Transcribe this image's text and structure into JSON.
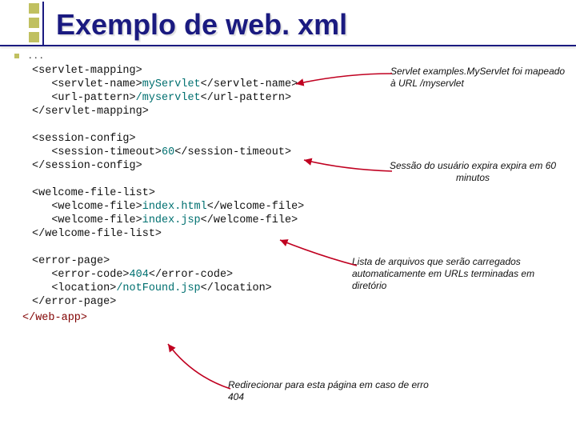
{
  "title": "Exemplo de web. xml",
  "dots": ". . .",
  "code": {
    "sm_open": "<servlet-mapping>",
    "sn_open": "<servlet-name>",
    "servlet_name": "myServlet",
    "sn_close": "</servlet-name>",
    "up_open": "<url-pattern>",
    "url_pattern": "/myservlet",
    "up_close": "</url-pattern>",
    "sm_close": "</servlet-mapping>",
    "sc_open": "<session-config>",
    "st_open": "<session-timeout>",
    "timeout": "60",
    "st_close": "</session-timeout>",
    "sc_close": "</session-config>",
    "wfl_open": "<welcome-file-list>",
    "wf_open1": "<welcome-file>",
    "wf1": "index.html",
    "wf_close1": "</welcome-file>",
    "wf_open2": "<welcome-file>",
    "wf2": "index.jsp",
    "wf_close2": "</welcome-file>",
    "wfl_close": "</welcome-file-list>",
    "ep_open": "<error-page>",
    "ec_open": "<error-code>",
    "error_code": "404",
    "ec_close": "</error-code>",
    "loc_open": "<location>",
    "location": "/notFound.jsp",
    "loc_close": "</location>",
    "ep_close": "</error-page>",
    "webapp_close": "</web-app>"
  },
  "annotations": {
    "a1": "Servlet examples.MyServlet foi mapeado à URL /myservlet",
    "a2": "Sessão do usuário expira expira em 60 minutos",
    "a3": "Lista de arquivos que serão carregados automaticamente em URLs terminadas em diretório",
    "a4": "Redirecionar para esta página em caso de erro 404"
  }
}
